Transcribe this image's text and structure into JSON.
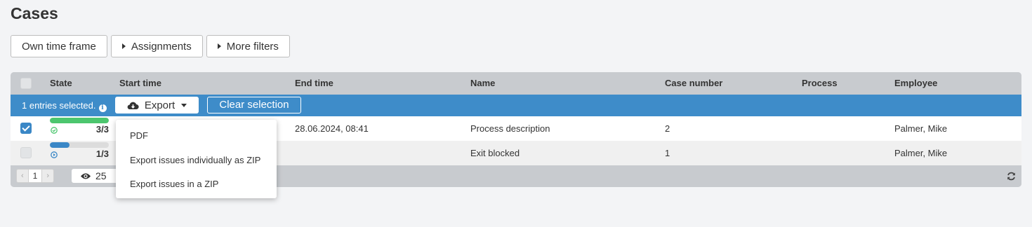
{
  "page": {
    "title": "Cases"
  },
  "filters": [
    {
      "label": "Own time frame",
      "caret": false
    },
    {
      "label": "Assignments",
      "caret": true
    },
    {
      "label": "More filters",
      "caret": true
    }
  ],
  "table": {
    "columns": [
      "State",
      "Start time",
      "End time",
      "Name",
      "Case number",
      "Process",
      "Employee"
    ],
    "selection": {
      "text": "1 entries selected.",
      "export_label": "Export",
      "clear_label": "Clear selection"
    },
    "rows": [
      {
        "checked": true,
        "progress": 1.0,
        "progress_color": "#4cc66e",
        "state_icon": "check-circle-icon",
        "state_count": "3/3",
        "start_time": "",
        "end_time": "28.06.2024, 08:41",
        "name": "Process description",
        "case_number": "2",
        "process": "",
        "employee": "Palmer, Mike"
      },
      {
        "checked": false,
        "progress": 0.33,
        "progress_color": "#3a87c6",
        "state_icon": "play-circle-icon",
        "state_count": "1/3",
        "start_time": "",
        "end_time": "",
        "name": "Exit blocked",
        "case_number": "1",
        "process": "",
        "employee": "Palmer, Mike"
      }
    ],
    "footer": {
      "prev": "‹",
      "page": "1",
      "next": "›",
      "page_size": "25",
      "refresh_icon": "refresh-icon"
    }
  },
  "export_menu": {
    "items": [
      "PDF",
      "Export issues individually as ZIP",
      "Export issues in a ZIP"
    ]
  },
  "colors": {
    "selection_bar": "#3e8cc9",
    "header": "#c8cbcf",
    "accent": "#3a87c6",
    "success": "#4cc66e"
  }
}
